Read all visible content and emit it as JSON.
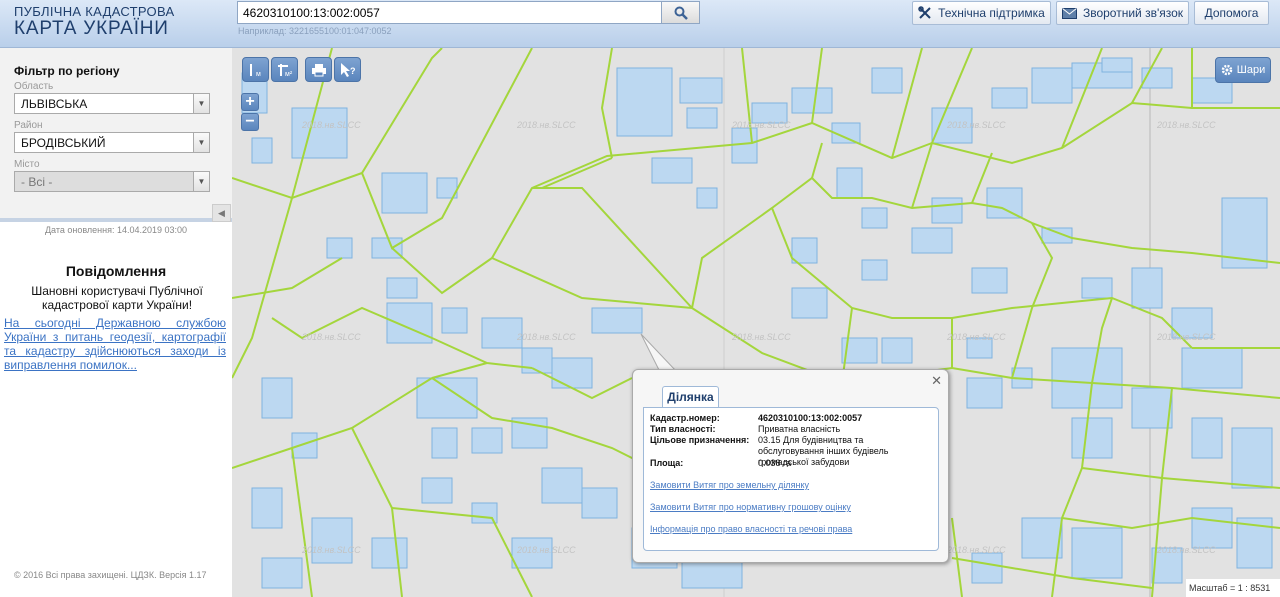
{
  "header": {
    "logo_line1": "ПУБЛІЧНА КАДАСТРОВА",
    "logo_line2": "КАРТА УКРАЇНИ",
    "search_value": "4620310100:13:002:0057",
    "search_hint": "Наприклад: 3221655100:01:047:0052",
    "tech_support": "Технічна підтримка",
    "feedback": "Зворотний зв'язок",
    "help": "Допомога"
  },
  "sidebar": {
    "filter_title": "Фільтр по регіону",
    "oblast_label": "Область",
    "oblast_value": "ЛЬВІВСЬКА",
    "rayon_label": "Район",
    "rayon_value": "БРОДІВСЬКИЙ",
    "city_label": "Місто",
    "city_value": "- Всі -",
    "update_date": "Дата оновлення: 14.04.2019 03:00",
    "message_title": "Повідомлення",
    "message_body": "Шановні користувачі Публічної кадастрової карти України!",
    "message_link": "На сьогодні Державною службою України з питань геодезії, картографії та кадастру здійснюються заходи із виправлення помилок...",
    "copyright": "© 2016 Всі права захищені. ЦДЗК. Версія 1.17"
  },
  "map": {
    "layers_label": "Шари",
    "scale": "Масштаб = 1 : 8531",
    "watermark": "2018.нв.SLCC",
    "colors": {
      "parcel_line": "#a4d63c",
      "building_fill": "#bcd8f1",
      "building_stroke": "#7fb3e0"
    }
  },
  "popup": {
    "tab": "Ділянка",
    "cadastral_label": "Кадастр.номер:",
    "cadastral_value": "4620310100:13:002:0057",
    "ownership_label": "Тип власності:",
    "ownership_value": "Приватна власність",
    "purpose_label": "Цільове призначення:",
    "purpose_value": "03.15 Для будівництва та обслуговування інших будівель громадської забудови",
    "area_label": "Площа:",
    "area_value": "0.038 га",
    "link1": "Замовити Витяг про земельну ділянку",
    "link2": "Замовити Витяг про нормативну грошову оцінку",
    "link3": "Інформація про право власності та речові права"
  }
}
